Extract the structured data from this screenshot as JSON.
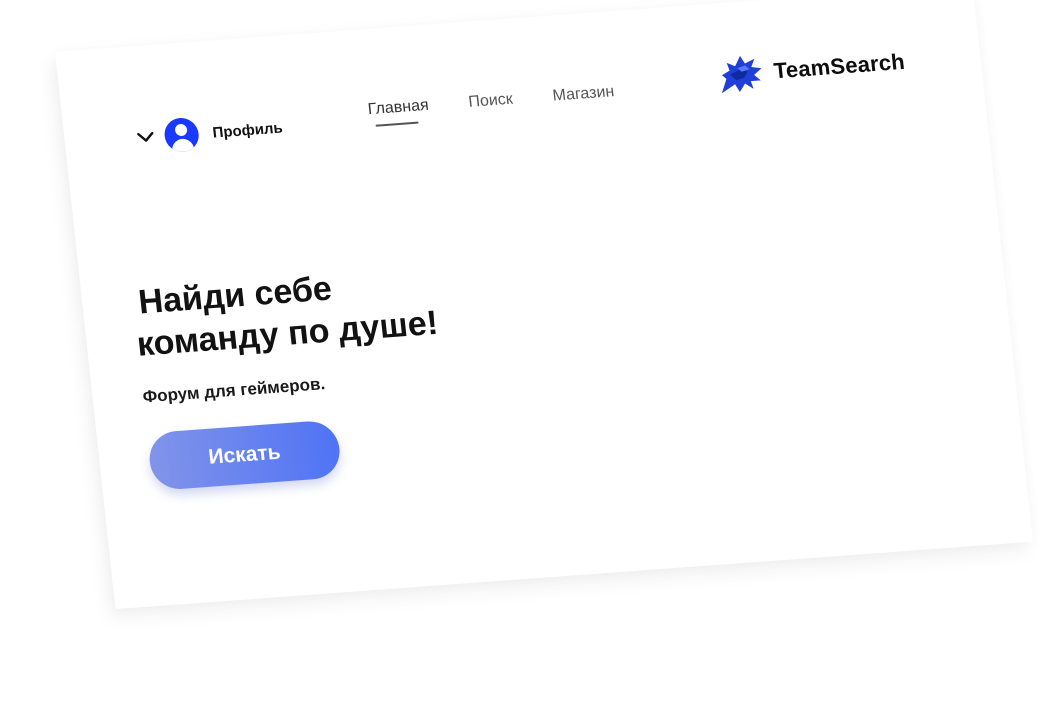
{
  "header": {
    "profile_label": "Профиль",
    "nav": [
      {
        "label": "Главная",
        "active": true
      },
      {
        "label": "Поиск",
        "active": false
      },
      {
        "label": "Магазин",
        "active": false
      }
    ],
    "brand_name": "TeamSearch"
  },
  "hero": {
    "title_line1": "Найди себе",
    "title_line2": "команду по душе!",
    "subtitle": "Форум для геймеров.",
    "cta_label": "Искать"
  },
  "colors": {
    "accent": "#1a39ff",
    "button_gradient_start": "#8294ea",
    "button_gradient_end": "#4f73f5"
  },
  "icons": {
    "profile_chevron": "chevron-down-icon",
    "avatar": "user-avatar-icon",
    "brand_logo": "wolf-logo-icon"
  }
}
